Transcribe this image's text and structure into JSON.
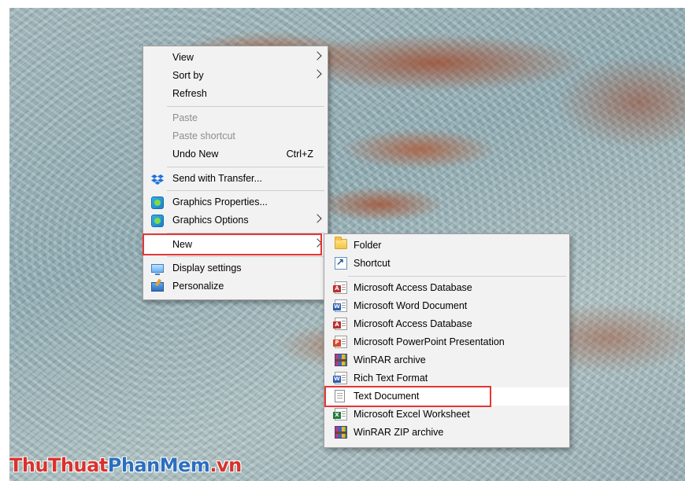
{
  "context_menu": {
    "items": [
      {
        "label": "View",
        "submenu": true
      },
      {
        "label": "Sort by",
        "submenu": true
      },
      {
        "label": "Refresh"
      },
      {
        "label": "Paste",
        "disabled": true
      },
      {
        "label": "Paste shortcut",
        "disabled": true
      },
      {
        "label": "Undo New",
        "shortcut": "Ctrl+Z"
      },
      {
        "label": "Send with Transfer...",
        "icon": "dropbox-icon"
      },
      {
        "label": "Graphics Properties...",
        "icon": "intel-graphics-icon"
      },
      {
        "label": "Graphics Options",
        "icon": "intel-graphics-icon",
        "submenu": true
      },
      {
        "label": "New",
        "submenu": true,
        "highlighted": true
      },
      {
        "label": "Display settings",
        "icon": "display-icon"
      },
      {
        "label": "Personalize",
        "icon": "personalize-icon"
      }
    ]
  },
  "new_submenu": {
    "items": [
      {
        "label": "Folder",
        "icon": "folder-icon"
      },
      {
        "label": "Shortcut",
        "icon": "shortcut-icon"
      },
      {
        "label": "Microsoft Access Database",
        "icon": "access-icon"
      },
      {
        "label": "Microsoft Word Document",
        "icon": "word-icon"
      },
      {
        "label": "Microsoft Access Database",
        "icon": "access-icon"
      },
      {
        "label": "Microsoft PowerPoint Presentation",
        "icon": "powerpoint-icon"
      },
      {
        "label": "WinRAR archive",
        "icon": "winrar-icon"
      },
      {
        "label": "Rich Text Format",
        "icon": "rtf-icon"
      },
      {
        "label": "Text Document",
        "icon": "text-document-icon",
        "highlighted": true
      },
      {
        "label": "Microsoft Excel Worksheet",
        "icon": "excel-icon"
      },
      {
        "label": "WinRAR ZIP archive",
        "icon": "winrar-zip-icon"
      }
    ]
  },
  "watermark": {
    "part1": "ThuThuat",
    "part2": "PhanMem",
    "part3": ".vn"
  },
  "colors": {
    "highlight_border": "#e53535",
    "menu_background": "#f2f2f2",
    "watermark_red": "#d8322c",
    "watermark_blue": "#2b6fbf"
  }
}
